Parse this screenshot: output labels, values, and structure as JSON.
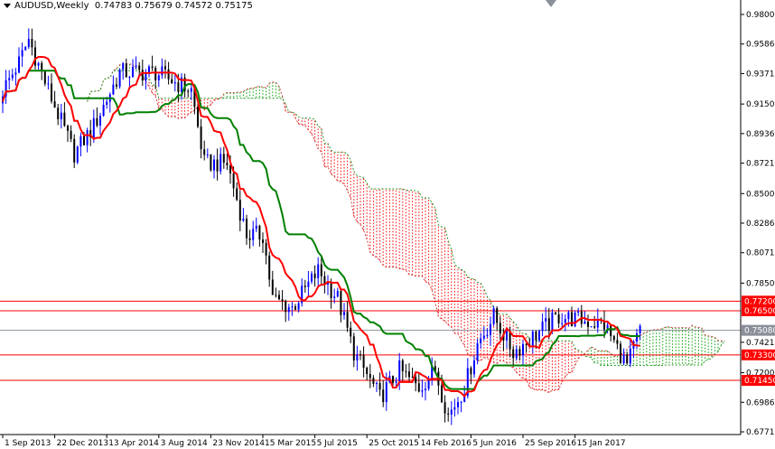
{
  "header": {
    "symbol": "AUDUSD,Weekly",
    "ohlc": "0.74783 0.75679 0.74572 0.75175"
  },
  "chart_data": {
    "type": "candlestick",
    "title": "AUDUSD,Weekly",
    "indicator": "Ichimoku Kinko Hyo (9,26,52)",
    "ylim": [
      0.67715,
      0.98005
    ],
    "y_ticks": [
      "0.98005",
      "0.95860",
      "0.93715",
      "0.91505",
      "0.89360",
      "0.87215",
      "0.85005",
      "0.82860",
      "0.80715",
      "0.78505",
      "0.74215",
      "0.72005",
      "0.69860",
      "0.67715"
    ],
    "x_ticks": [
      "1 Sep 2013",
      "22 Dec 2013",
      "13 Apr 2014",
      "3 Aug 2014",
      "23 Nov 2014",
      "15 Mar 2015",
      "5 Jul 2015",
      "25 Oct 2015",
      "14 Feb 2016",
      "5 Jun 2016",
      "25 Sep 2016",
      "15 Jan 2017"
    ],
    "weeks_per_x_tick": 16,
    "close_keyframes_week_price": [
      [
        0,
        0.925
      ],
      [
        5,
        0.945
      ],
      [
        8,
        0.962
      ],
      [
        14,
        0.925
      ],
      [
        22,
        0.879
      ],
      [
        28,
        0.899
      ],
      [
        36,
        0.938
      ],
      [
        47,
        0.938
      ],
      [
        58,
        0.925
      ],
      [
        62,
        0.872
      ],
      [
        69,
        0.872
      ],
      [
        75,
        0.82
      ],
      [
        80,
        0.82
      ],
      [
        83,
        0.774
      ],
      [
        89,
        0.767
      ],
      [
        97,
        0.794
      ],
      [
        103,
        0.774
      ],
      [
        108,
        0.735
      ],
      [
        116,
        0.702
      ],
      [
        122,
        0.722
      ],
      [
        128,
        0.709
      ],
      [
        133,
        0.722
      ],
      [
        137,
        0.689
      ],
      [
        142,
        0.709
      ],
      [
        146,
        0.741
      ],
      [
        151,
        0.761
      ],
      [
        157,
        0.735
      ],
      [
        164,
        0.748
      ],
      [
        171,
        0.761
      ],
      [
        178,
        0.758
      ],
      [
        185,
        0.755
      ],
      [
        192,
        0.725
      ],
      [
        196,
        0.751
      ]
    ],
    "levels": [
      {
        "price": "0.77200",
        "color": "#ff0000"
      },
      {
        "price": "0.76500",
        "color": "#ff0000"
      },
      {
        "price": "0.75080",
        "color": "#8a8f99"
      },
      {
        "price": "0.73300",
        "color": "#ff0000"
      },
      {
        "price": "0.71450",
        "color": "#ff0000"
      }
    ],
    "colors": {
      "bull": "#0000ff",
      "bear": "#000000",
      "tenkan": "#ff0000",
      "kijun": "#008000",
      "cloud_bear": "#ff0000",
      "cloud_bull": "#00a000"
    }
  }
}
